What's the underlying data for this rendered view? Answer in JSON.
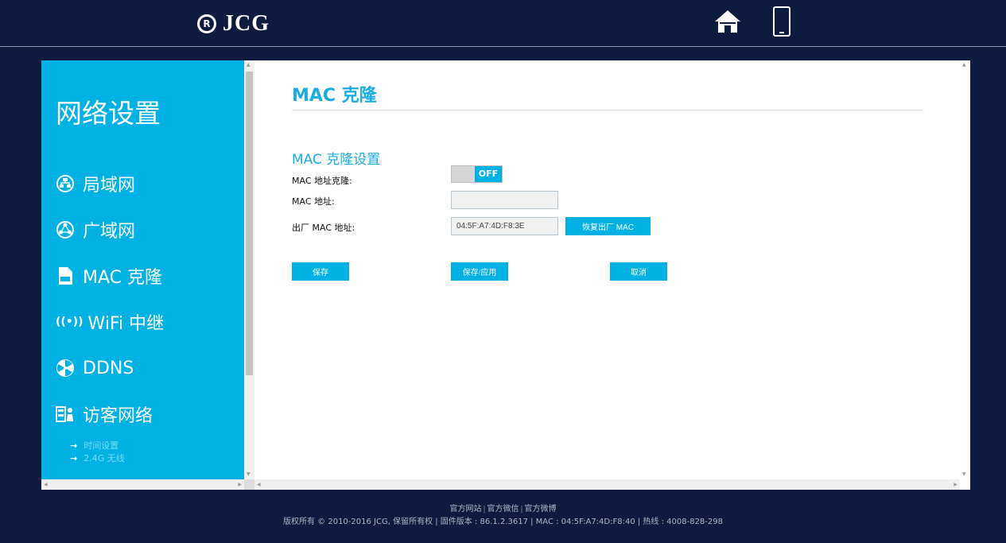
{
  "header": {
    "logo_mark": "R",
    "brand": "JCG"
  },
  "sidebar": {
    "title": "网络设置",
    "items": [
      {
        "label": "局域网",
        "icon": "lan-icon"
      },
      {
        "label": "广域网",
        "icon": "wan-icon"
      },
      {
        "label": "MAC 克隆",
        "icon": "mac-clone-icon"
      },
      {
        "label": "WiFi 中继",
        "icon": "wifi-repeater-icon"
      },
      {
        "label": "DDNS",
        "icon": "ddns-icon"
      },
      {
        "label": "访客网络",
        "icon": "guest-network-icon"
      }
    ],
    "subitems": [
      {
        "label": "时间设置"
      },
      {
        "label": "2.4G 无线"
      }
    ],
    "wifi_glyph": "((•))"
  },
  "main": {
    "page_title": "MAC 克隆",
    "section_title": "MAC 克隆设置",
    "fields": {
      "mac_clone_label": "MAC 地址克隆:",
      "mac_clone_state": "OFF",
      "mac_address_label": "MAC 地址:",
      "mac_address_value": "",
      "factory_mac_label": "出厂 MAC 地址:",
      "factory_mac_value": "04:5F:A7:4D:F8:3E"
    },
    "buttons": {
      "restore_factory_mac": "恢复出厂 MAC",
      "save": "保存",
      "save_apply": "保存/应用",
      "cancel": "取消"
    }
  },
  "footer": {
    "links": [
      "官方网站",
      "官方微信",
      "官方微博"
    ],
    "separator": "|",
    "copyright": "版权所有 © 2010-2016 JCG, 保留所有权  |  固件版本 : 86.1.2.3617  |  MAC : 04:5F:A7:4D:F8:40  |  热线 : 4008-828-298"
  },
  "colors": {
    "background": "#0d1b3e",
    "accent": "#00b1e4",
    "title_blue": "#1aace4"
  }
}
